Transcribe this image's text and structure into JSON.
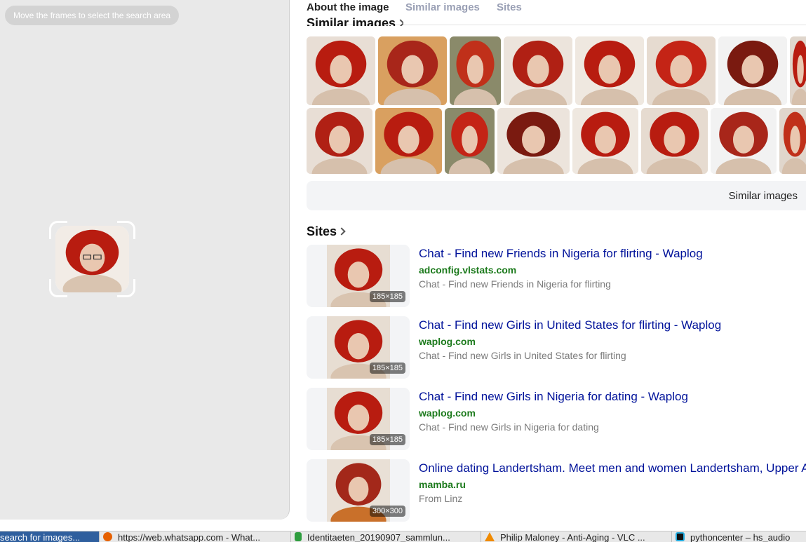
{
  "left_pane": {
    "hint": "Move the frames to select the search area"
  },
  "tabs": [
    "About the image",
    "Similar images",
    "Sites"
  ],
  "similar_section": {
    "title": "Similar images"
  },
  "similar_bar": {
    "label": "Similar images"
  },
  "sites_section": {
    "title": "Sites"
  },
  "sites": [
    {
      "title": "Chat - Find new Friends in Nigeria for flirting - Waplog",
      "domain": "adconfig.vlstats.com",
      "desc": "Chat - Find new Friends in Nigeria for flirting",
      "size": "185×185"
    },
    {
      "title": "Chat - Find new Girls in United States for flirting - Waplog",
      "domain": "waplog.com",
      "desc": "Chat - Find new Girls in United States for flirting",
      "size": "185×185"
    },
    {
      "title": "Chat - Find new Girls in Nigeria for dating - Waplog",
      "domain": "waplog.com",
      "desc": "Chat - Find new Girls in Nigeria for dating",
      "size": "185×185"
    },
    {
      "title": "Online dating Landertsham. Meet men and women Landertsham, Upper Austria",
      "domain": "mamba.ru",
      "desc": "From Linz",
      "size": "300×300"
    }
  ],
  "taskbar": [
    {
      "label": "search for images...",
      "icon": "browser-icon",
      "color": "#2f5f9e"
    },
    {
      "label": "https://web.whatsapp.com - What...",
      "icon": "firefox-icon",
      "color": "#e66000"
    },
    {
      "label": "Identitaeten_20190907_sammlun...",
      "icon": "spreadsheet-icon",
      "color": "#2e9d3e"
    },
    {
      "label": "Philip Maloney - Anti-Aging - VLC ...",
      "icon": "vlc-icon",
      "color": "#f08a00"
    },
    {
      "label": "pythoncenter – hs_audio",
      "icon": "pycharm-icon",
      "color": "#111111"
    }
  ],
  "colors": {
    "accent_title": "#00129a",
    "domain_green": "#1c7a1c",
    "hair_red": "#b81c10"
  }
}
